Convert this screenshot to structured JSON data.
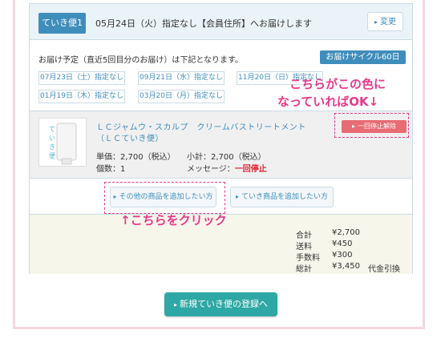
{
  "header": {
    "tag_label": "ていき便1",
    "delivery_text": "05月24日（火）指定なし【会員住所】へお届けします",
    "change_label": "変更"
  },
  "schedule": {
    "intro": "お届け予定（直近5回目分のお届け）は下記となります。",
    "cycle_label": "お届けサイクル60日",
    "dates": [
      "07月23日（土）指定なし",
      "09月21日（水）指定なし",
      "11月20日（日）指定なし",
      "01月19日（木）指定なし",
      "03月20日（月）指定なし"
    ]
  },
  "annotations": {
    "color_note_line1": "こちらがこの色に",
    "color_note_line2": "なっていればOK↓",
    "click_note": "↑こちらをクリック"
  },
  "product": {
    "name": "ＬＣジャムウ・スカルプ　クリームバストリートメント（ＬＣていき便）",
    "unit_price_label": "単価：2,700（税込）",
    "subtotal_label": "小計：2,700（税込）",
    "quantity_label": "個数：1",
    "message_label": "メッセージ：",
    "message_value": "一回停止",
    "stop_button_label": "一回停止解除"
  },
  "add_buttons": {
    "other_label": "その他の商品を追加したい方",
    "teiki_label": "ていき商品を追加したい方"
  },
  "totals": {
    "rows": [
      {
        "label": "合計",
        "value": "¥2,700"
      },
      {
        "label": "送料",
        "value": "¥450"
      },
      {
        "label": "手数料",
        "value": "¥300"
      },
      {
        "label": "総計",
        "value": "¥3,450"
      }
    ],
    "payment_method": "代金引換"
  },
  "register_button_label": "新規ていき便の登録へ",
  "icons": {
    "arrow": "chevron-right-icon",
    "product_image": "product-tube-image"
  },
  "colors": {
    "accent_blue": "#3f8dbb",
    "annotation_pink": "#e8398a",
    "stop_button": "#e96b73",
    "register_button": "#2ea8a5",
    "frame_pink": "#f7d6de"
  }
}
